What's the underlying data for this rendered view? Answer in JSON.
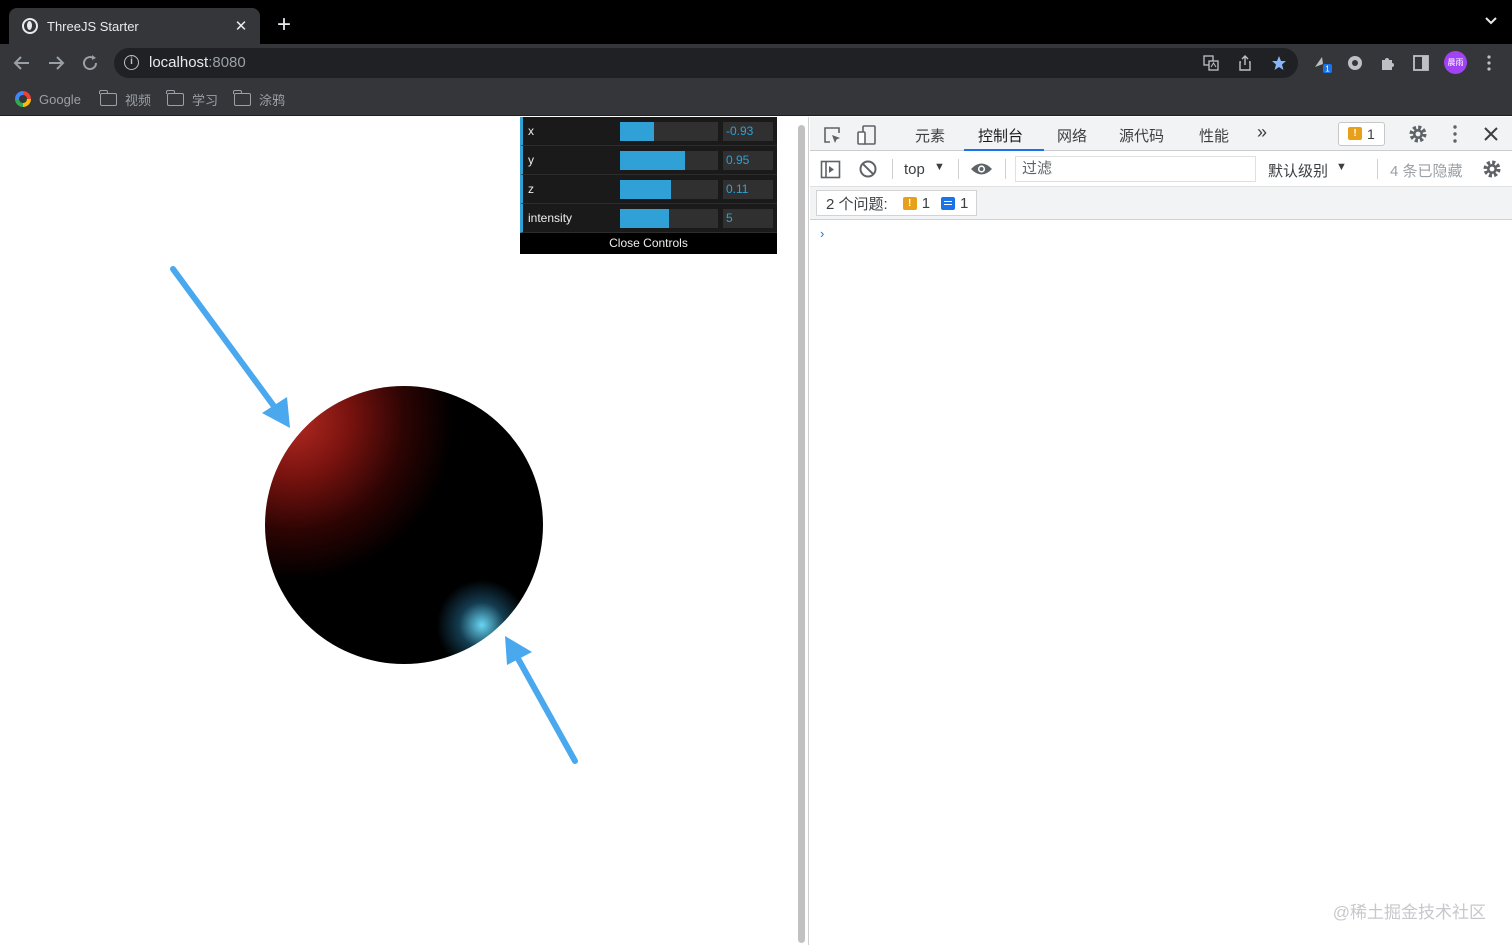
{
  "browser": {
    "tab_title": "ThreeJS Starter",
    "tab_close": "✕",
    "new_tab": "+",
    "url_host": "localhost",
    "url_port": ":8080",
    "profile_initials": "晨雨",
    "extension_badge": "1",
    "bookmarks": [
      {
        "label": "Google",
        "icon": "google-icon"
      },
      {
        "label": "视频",
        "icon": "folder-icon"
      },
      {
        "label": "学习",
        "icon": "folder-icon"
      },
      {
        "label": "涂鸦",
        "icon": "folder-icon"
      }
    ]
  },
  "gui": {
    "controls": [
      {
        "label": "x",
        "value": "-0.93",
        "fraction": 0.35
      },
      {
        "label": "y",
        "value": "0.95",
        "fraction": 0.66
      },
      {
        "label": "z",
        "value": "0.11",
        "fraction": 0.52
      },
      {
        "label": "intensity",
        "value": "5",
        "fraction": 0.5
      }
    ],
    "close_label": "Close Controls",
    "accent": "#2fa1d6"
  },
  "scene": {
    "sphere_light_color": "#b42a22",
    "rim_light_color": "#6ee1ff",
    "arrow_color": "#4aa8ee"
  },
  "devtools": {
    "tabs": [
      "元素",
      "控制台",
      "网络",
      "源代码",
      "性能"
    ],
    "active_tab": "控制台",
    "more_tabs": "»",
    "issues_count": "1",
    "context": "top",
    "filter_placeholder": "过滤",
    "level": "默认级别",
    "hidden_count": "4 条已隐藏",
    "issues_label": "2 个问题:",
    "warning_count": "1",
    "info_count": "1",
    "prompt_symbol": "›"
  },
  "watermark": "@稀土掘金技术社区"
}
